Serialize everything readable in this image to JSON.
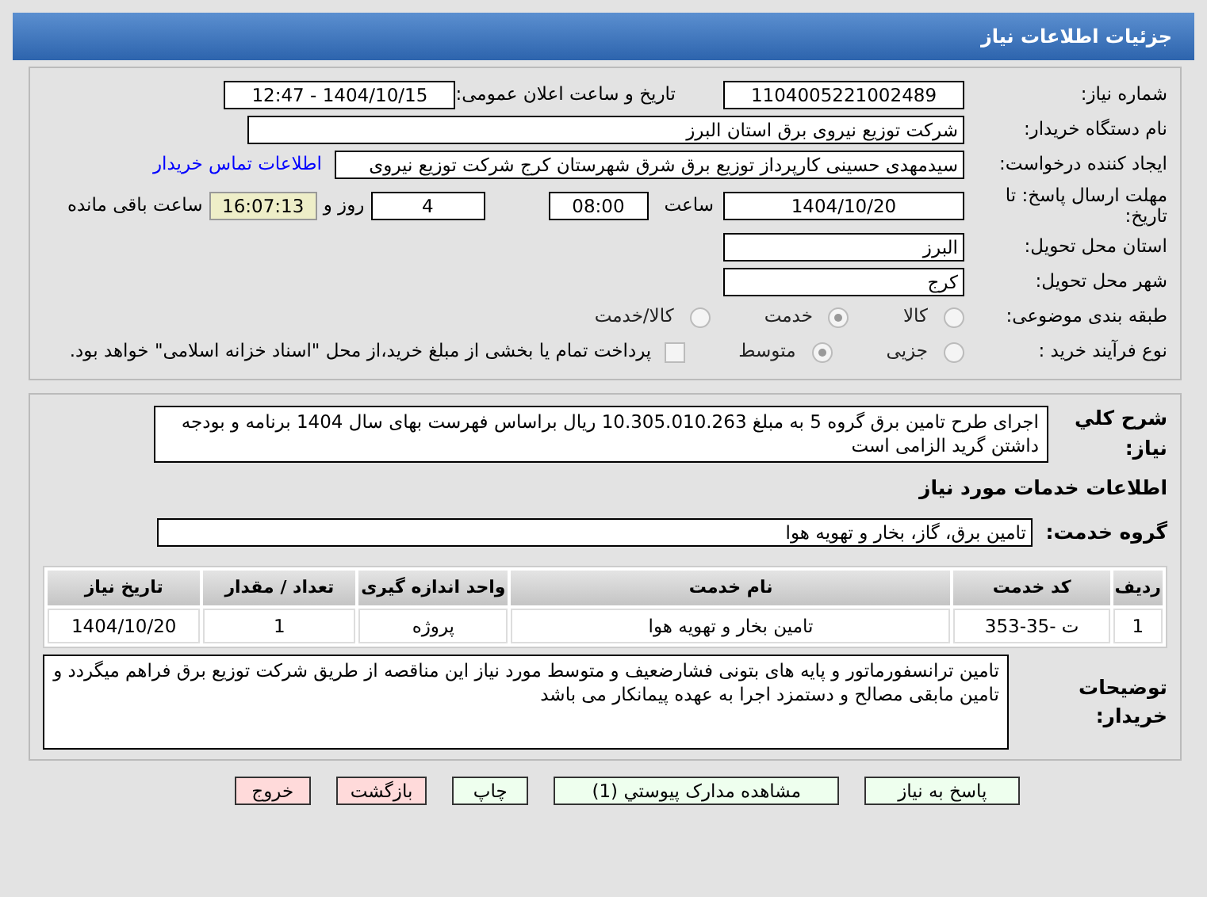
{
  "header": {
    "title": "جزئیات اطلاعات نیاز"
  },
  "need_number": {
    "label": "شماره نیاز:",
    "value": "1104005221002489"
  },
  "announce": {
    "label": "تاریخ و ساعت اعلان عمومی:",
    "value": "1404/10/15 - 12:47"
  },
  "buyer": {
    "label": "نام دستگاه خریدار:",
    "value": "شرکت توزیع نیروی برق استان البرز"
  },
  "requester": {
    "label": "ایجاد کننده درخواست:",
    "value": "سیدمهدی حسینی کارپرداز توزیع برق شرق شهرستان کرج شرکت توزیع نیروی",
    "link": "اطلاعات تماس خریدار"
  },
  "deadline": {
    "label": "مهلت ارسال پاسخ: تا تاریخ:",
    "date": "1404/10/20",
    "time_label": "ساعت",
    "time": "08:00",
    "days": "4",
    "days_label": "روز و",
    "remaining": "16:07:13",
    "remaining_label": "ساعت باقی مانده"
  },
  "province": {
    "label": "استان محل تحویل:",
    "value": "البرز"
  },
  "city": {
    "label": "شهر محل تحویل:",
    "value": "کرج"
  },
  "category": {
    "label": "طبقه بندی موضوعی:",
    "options": [
      {
        "label": "کالا",
        "selected": false
      },
      {
        "label": "خدمت",
        "selected": true
      },
      {
        "label": "کالا/خدمت",
        "selected": false
      }
    ]
  },
  "process": {
    "label": "نوع فرآیند خرید :",
    "options": [
      {
        "label": "جزیی",
        "selected": false
      },
      {
        "label": "متوسط",
        "selected": true
      }
    ],
    "payment": {
      "checked": false,
      "text": "پرداخت تمام یا بخشی از مبلغ خرید،از محل \"اسناد خزانه اسلامی\" خواهد بود."
    }
  },
  "description": {
    "label": "شرح کلي نياز:",
    "value": "اجرای طرح تامین برق گروه 5 به مبلغ 10.305.010.263 ریال براساس فهرست بهای سال 1404 برنامه و بودجه داشتن گرید الزامی است"
  },
  "services_title": "اطلاعات خدمات مورد نیاز",
  "service_group": {
    "label": "گروه خدمت:",
    "value": "تامین برق، گاز، بخار و تهویه هوا"
  },
  "table": {
    "columns": [
      "ردیف",
      "کد خدمت",
      "نام خدمت",
      "واحد اندازه گیری",
      "تعداد / مقدار",
      "تاریخ نیاز"
    ],
    "rows": [
      [
        "1",
        "ت -35-353",
        "تامین بخار و تهویه هوا",
        "پروژه",
        "1",
        "1404/10/20"
      ]
    ]
  },
  "buyer_notes": {
    "label": "توضیحات خریدار:",
    "value": "تامین ترانسفورماتور و پایه های بتونی فشارضعیف و متوسط مورد نیاز این مناقصه از طریق شرکت توزیع برق فراهم میگردد و تامین مابقی مصالح و دستمزد اجرا به عهده پیمانکار می باشد"
  },
  "buttons": [
    {
      "label": "پاسخ به نیاز",
      "kind": "green"
    },
    {
      "label": "مشاهده مدارک پیوستي (1)",
      "kind": "green"
    },
    {
      "label": "چاپ",
      "kind": "green"
    },
    {
      "label": "بازگشت",
      "kind": "red"
    },
    {
      "label": "خروج",
      "kind": "red"
    }
  ]
}
